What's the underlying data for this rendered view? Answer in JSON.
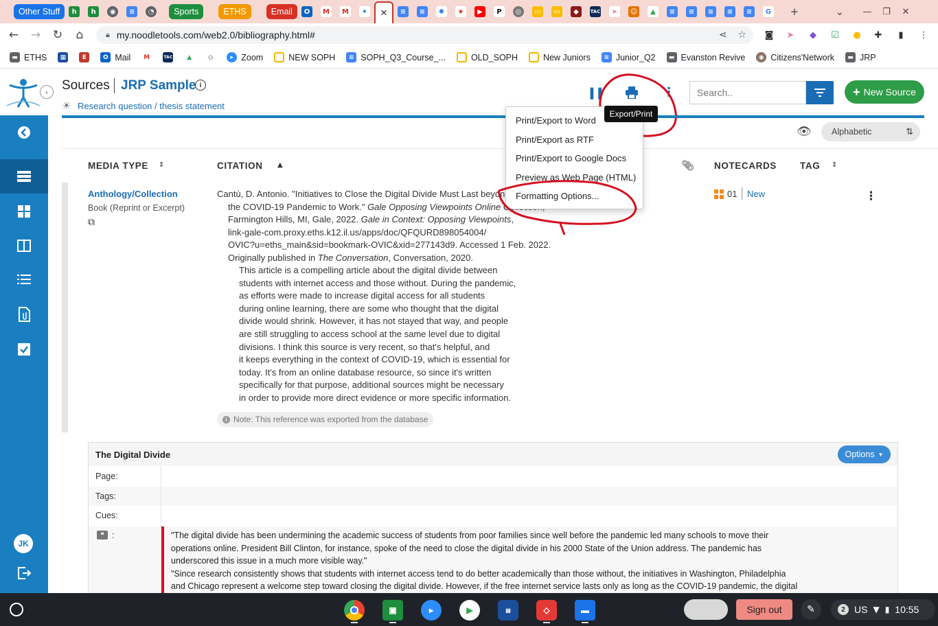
{
  "browser": {
    "tab_groups": [
      {
        "label": "Other Stuff",
        "color": "#1a73e8"
      },
      {
        "label": "Sports",
        "color": "#1e8e3e"
      },
      {
        "label": "ETHS",
        "color": "#f29900"
      },
      {
        "label": "Email",
        "color": "#d93025"
      }
    ],
    "url": "my.noodletools.com/web2.0/bibliography.html#",
    "bookmarks": [
      {
        "label": "ETHS",
        "icon": "folder-icon"
      },
      {
        "label": "",
        "icon": "calendar-icon"
      },
      {
        "label": "",
        "icon": "e-icon"
      },
      {
        "label": "Mail",
        "icon": "outlook-icon"
      },
      {
        "label": "",
        "icon": "gmail-icon"
      },
      {
        "label": "",
        "icon": "tac-icon"
      },
      {
        "label": "",
        "icon": "drive-icon"
      },
      {
        "label": "",
        "icon": "shield-icon"
      },
      {
        "label": "Zoom",
        "icon": "zoom-icon"
      },
      {
        "label": "NEW SOPH",
        "icon": "folder-yellow-icon"
      },
      {
        "label": "SOPH_Q3_Course_...",
        "icon": "docs-icon"
      },
      {
        "label": "OLD_SOPH",
        "icon": "folder-yellow-icon"
      },
      {
        "label": "New Juniors",
        "icon": "folder-yellow-icon"
      },
      {
        "label": "Junior_Q2",
        "icon": "docs-icon"
      },
      {
        "label": "Evanston Revive",
        "icon": "folder-icon"
      },
      {
        "label": "Citizens'Network",
        "icon": "globe-icon"
      },
      {
        "label": "JRP",
        "icon": "folder-icon"
      }
    ]
  },
  "app": {
    "section_title": "Sources",
    "project_name": "JRP Sample",
    "research_link": "Research question / thesis statement",
    "search_placeholder": "Search..",
    "new_source_label": "New Source",
    "sort_label": "Alphabetic",
    "tooltip": "Export/Print",
    "user_initials": "JK"
  },
  "export_menu": [
    "Print/Export to Word",
    "Print/Export as RTF",
    "Print/Export to Google Docs",
    "Preview as Web Page (HTML)",
    "Formatting Options..."
  ],
  "table": {
    "headers": {
      "media_type": "MEDIA TYPE",
      "citation": "CITATION",
      "notecards": "NOTECARDS",
      "tag": "TAG"
    },
    "row": {
      "media_type": "Anthology/Collection",
      "media_sub": "Book (Reprint or Excerpt)",
      "notecard_count": "01",
      "notecard_new": "New",
      "citation_lines": [
        "Cantù, D. Antonio. \"Initiatives to Close the Digital Divide Must Last beyond",
        "the COVID-19 Pandemic to Work.\" ",
        "Farmington Hills, MI, Gale, 2022. ",
        "link-gale-com.proxy.eths.k12.il.us/apps/doc/QFQURD898054004/",
        "OVIC?u=eths_main&sid=bookmark-OVIC&xid=277143d9. Accessed 1 Feb. 2022.",
        "Originally published in "
      ],
      "citation_italics": {
        "gale_opposing": "Gale Opposing Viewpoints Online",
        "collection": " Collection,",
        "gale_context": "Gale in Context: Opposing Viewpoints",
        "comma": ",",
        "the_conversation": "The Conversation",
        "conv_tail": ", Conversation, 2020."
      },
      "annotation_lines": [
        "This article is a compelling article about the digital divide between",
        "students with internet access and those without. During the pandemic,",
        "as efforts were made to increase digital access for all students",
        "during online learning, there are some who thought that the digital",
        "divide would shrink. However, it has not stayed that way, and people",
        "are still struggling to access school at the same level due to digital",
        "divisions. I think this source is very recent, so that's helpful, and",
        "it keeps everything in the context of COVID-19, which is essential for",
        "today. It's from an online database resource, so since it's written",
        "specifically for that purpose, additional sources might be necessary",
        "in order to provide more direct evidence or more specific information."
      ],
      "note": "Note: This reference was exported from the database"
    }
  },
  "notecard": {
    "title": "The Digital Divide",
    "options_label": "Options",
    "labels": {
      "page": "Page:",
      "tags": "Tags:",
      "cues": "Cues:",
      "quote": ":"
    },
    "quote_lines": [
      "\"The digital divide has been undermining the academic success of students from poor families since well before the pandemic led many schools to move their",
      "operations online. President Bill Clinton, for instance, spoke of the need to close the digital divide in his 2000 State of the Union address. The pandemic has",
      "underscored this issue in a much more visible way.\"",
      "\"Since research consistently shows that students with internet access tend to do better academically than those without, the initiatives in Washington, Philadelphia",
      "and Chicago represent a welcome step toward closing the digital divide. However, if the free internet service lasts only as long as the COVID-19 pandemic, the digital"
    ]
  },
  "shelf": {
    "sign_out": "Sign out",
    "notifications": "2",
    "locale": "US",
    "time": "10:55"
  }
}
